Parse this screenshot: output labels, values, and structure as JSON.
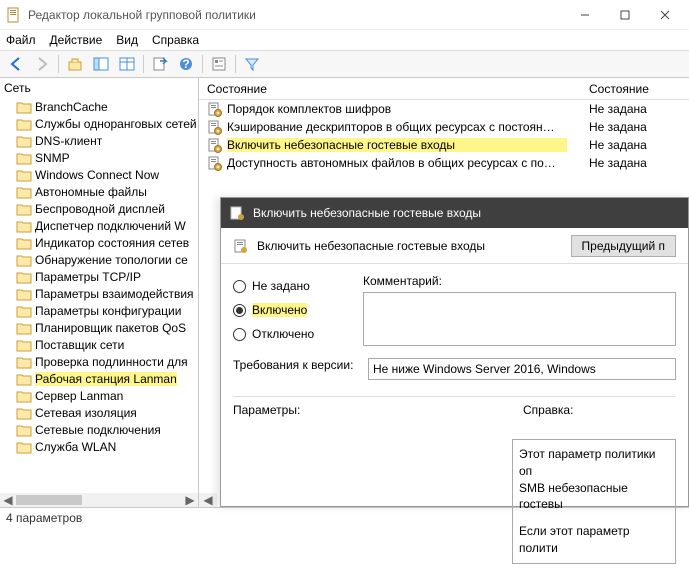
{
  "window": {
    "title": "Редактор локальной групповой политики"
  },
  "menu": {
    "file": "Файл",
    "action": "Действие",
    "view": "Вид",
    "help": "Справка"
  },
  "tree": {
    "root": "Сеть",
    "items": [
      {
        "label": "BranchCache"
      },
      {
        "label": "Службы одноранговых сетей"
      },
      {
        "label": "DNS-клиент"
      },
      {
        "label": "SNMP"
      },
      {
        "label": "Windows Connect Now"
      },
      {
        "label": "Автономные файлы"
      },
      {
        "label": "Беспроводной дисплей"
      },
      {
        "label": "Диспетчер подключений W"
      },
      {
        "label": "Индикатор состояния сетев"
      },
      {
        "label": "Обнаружение топологии се"
      },
      {
        "label": "Параметры TCP/IP"
      },
      {
        "label": "Параметры взаимодействия"
      },
      {
        "label": "Параметры конфигурации"
      },
      {
        "label": "Планировщик пакетов QoS"
      },
      {
        "label": "Поставщик сети"
      },
      {
        "label": "Проверка подлинности для"
      },
      {
        "label": "Рабочая станция Lanman",
        "selected": true
      },
      {
        "label": "Сервер Lanman"
      },
      {
        "label": "Сетевая изоляция"
      },
      {
        "label": "Сетевые подключения"
      },
      {
        "label": "Служба WLAN"
      }
    ]
  },
  "list": {
    "col_state": "Состояние",
    "col_state2": "Состояние",
    "rows": [
      {
        "name": "Порядок комплектов шифров",
        "state": "Не задана"
      },
      {
        "name": "Кэширование дескрипторов в общих ресурсах с постоян…",
        "state": "Не задана"
      },
      {
        "name": "Включить небезопасные гостевые входы",
        "state": "Не задана",
        "highlight": true
      },
      {
        "name": "Доступность автономных файлов в общих ресурсах с по…",
        "state": "Не задана"
      }
    ]
  },
  "dialog": {
    "title": "Включить небезопасные гостевые входы",
    "subtitle": "Включить небезопасные гостевые входы",
    "prev_button": "Предыдущий п",
    "radio_not_set": "Не задано",
    "radio_enabled": "Включено",
    "radio_disabled": "Отключено",
    "comment_label": "Комментарий:",
    "requirements_label": "Требования к версии:",
    "requirements_value": "Не ниже Windows Server 2016, Windows",
    "params_label": "Параметры:",
    "help_label": "Справка:",
    "help_text_1": "Этот параметр политики оп",
    "help_text_2": "SMB небезопасные гостевы",
    "help_text_3": "Если этот параметр полити"
  },
  "status": {
    "text": "4 параметров"
  }
}
